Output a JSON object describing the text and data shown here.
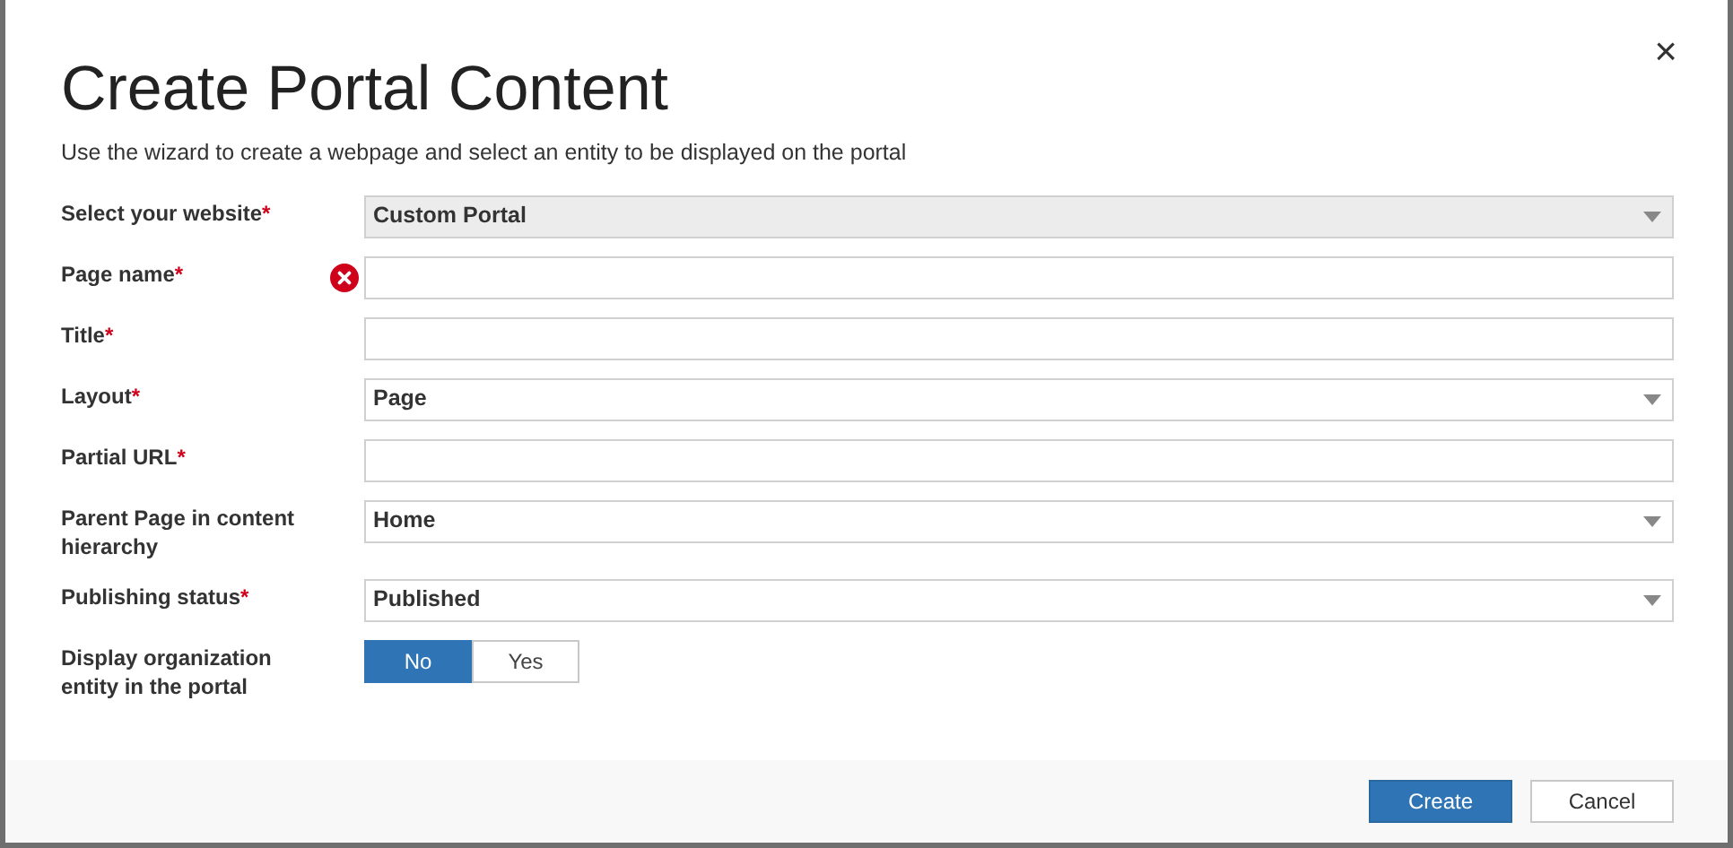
{
  "dialog": {
    "title": "Create Portal Content",
    "subtitle": "Use the wizard to create a webpage and select an entity to be displayed on the portal",
    "close": "×"
  },
  "fields": [
    {
      "kind": "select",
      "label": "Select your website",
      "required_mark": "*",
      "value": "Custom Portal",
      "disabled": true,
      "error": false
    },
    {
      "kind": "text",
      "label": "Page name",
      "required_mark": "*",
      "disabled": false,
      "error": true
    },
    {
      "kind": "text",
      "label": "Title",
      "required_mark": "*",
      "disabled": false,
      "error": false
    },
    {
      "kind": "select",
      "label": "Layout",
      "required_mark": "*",
      "value": "Page",
      "disabled": false,
      "error": false
    },
    {
      "kind": "text",
      "label": "Partial URL",
      "required_mark": "*",
      "disabled": false,
      "error": false
    },
    {
      "kind": "select",
      "label": "Parent Page in content hierarchy",
      "value": "Home",
      "disabled": false,
      "error": false
    },
    {
      "kind": "select",
      "label": "Publishing status",
      "required_mark": "*",
      "value": "Published",
      "disabled": false,
      "error": false
    },
    {
      "kind": "toggle",
      "label": "Display organization entity in the portal",
      "options": [
        {
          "label": "No",
          "selected": true
        },
        {
          "label": "Yes",
          "selected": false
        }
      ]
    }
  ],
  "buttons": [
    {
      "label": "Create",
      "primary": true
    },
    {
      "label": "Cancel",
      "primary": false
    }
  ]
}
